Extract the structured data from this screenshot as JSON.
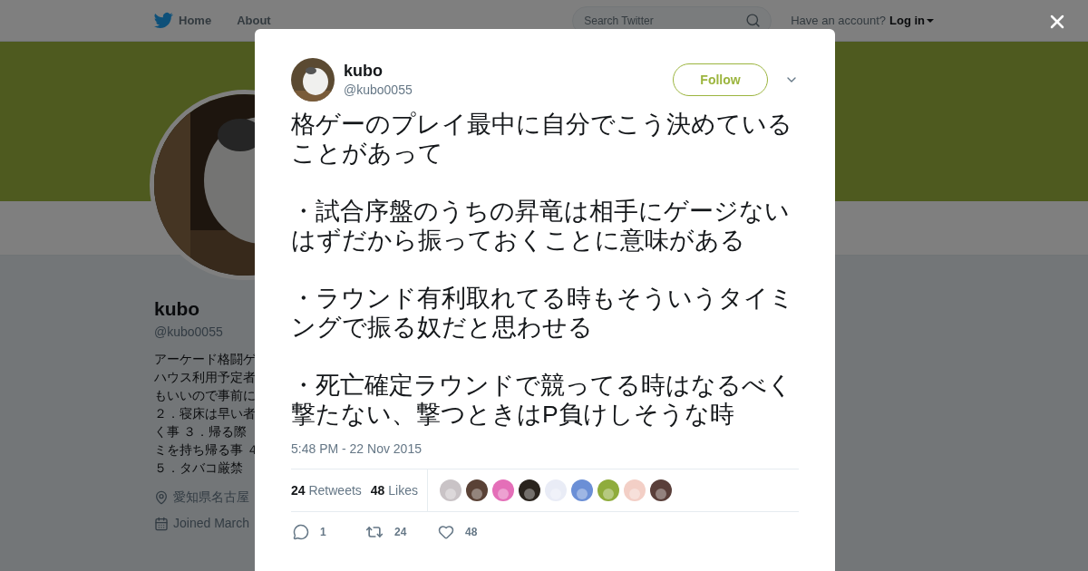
{
  "nav": {
    "links": [
      "Home",
      "About"
    ],
    "search": {
      "placeholder": "Search Twitter"
    },
    "account_prompt": "Have an account?",
    "login": "Log in"
  },
  "profile": {
    "name": "kubo",
    "handle": "@kubo0055",
    "bio_lines": [
      "アーケード格闘ゲ",
      "ハウス利用予定者",
      "もいいので事前に",
      "２．寝床は早い者",
      "く事 ３．帰る際",
      "ミを持ち帰る事 ４",
      "５．タバコ厳禁"
    ],
    "location": "愛知県名古屋",
    "joined": "Joined March"
  },
  "tweet": {
    "name": "kubo",
    "handle": "@kubo0055",
    "follow": "Follow",
    "paragraphs": [
      "格ゲーのプレイ最中に自分でこう決めていることがあって",
      "・試合序盤のうちの昇竜は相手にゲージないはずだから振っておくことに意味がある",
      "・ラウンド有利取れてる時もそういうタイミングで振る奴だと思わせる",
      "・死亡確定ラウンドで競ってる時はなるべく撃たない、撃つときはP負けしそうな時"
    ],
    "time": "5:48 PM - 22 Nov 2015",
    "stats": [
      {
        "count": "24",
        "label": "Retweets"
      },
      {
        "count": "48",
        "label": "Likes"
      }
    ],
    "likers": [
      {
        "color": "#c9c3c6"
      },
      {
        "color": "#5a4236"
      },
      {
        "color": "#e46fb8"
      },
      {
        "color": "#2a241e"
      },
      {
        "color": "#e9ecf6"
      },
      {
        "color": "#6b8fd6"
      },
      {
        "color": "#8fac3c"
      },
      {
        "color": "#f3cfc6"
      },
      {
        "color": "#5a3f3a"
      }
    ],
    "actions": [
      {
        "kind": "reply",
        "count": "1"
      },
      {
        "kind": "retweet",
        "count": "24"
      },
      {
        "kind": "like",
        "count": "48"
      }
    ]
  }
}
